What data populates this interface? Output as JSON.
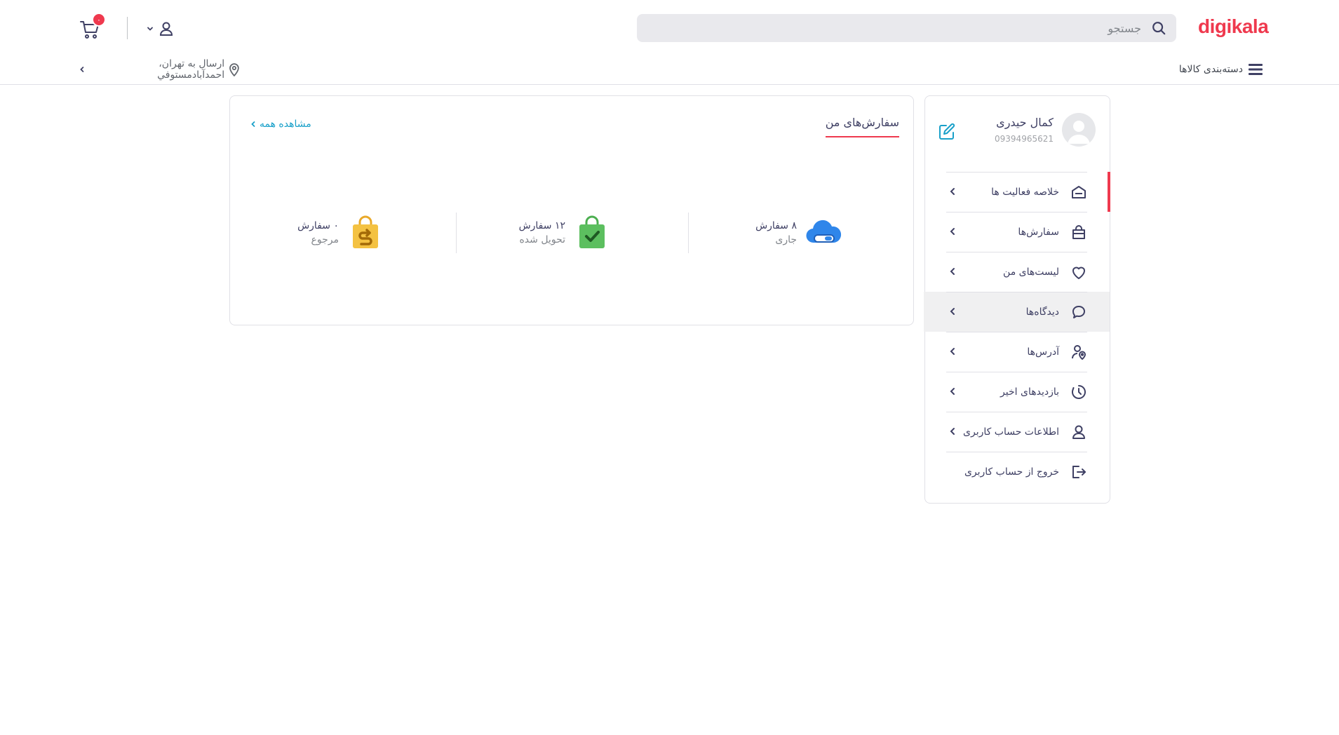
{
  "header": {
    "logo": "digikala",
    "search_placeholder": "جستجو",
    "cart_count": "۰",
    "categories_label": "دسته‌بندی کالاها",
    "location_label": "ارسال به تهران، احمدآبادمستوفي"
  },
  "sidebar": {
    "user_name": "کمال حیدری",
    "user_phone": "09394965621",
    "items": [
      {
        "label": "خلاصه فعالیت ها",
        "icon": "home-icon"
      },
      {
        "label": "سفارش‌ها",
        "icon": "bag-icon"
      },
      {
        "label": "لیست‌های من",
        "icon": "heart-icon"
      },
      {
        "label": "دیدگاه‌ها",
        "icon": "comment-icon"
      },
      {
        "label": "آدرس‌ها",
        "icon": "location-icon"
      },
      {
        "label": "بازدیدهای اخیر",
        "icon": "clock-icon"
      },
      {
        "label": "اطلاعات حساب کاربری",
        "icon": "user-icon"
      },
      {
        "label": "خروج از حساب کاربری",
        "icon": "logout-icon"
      }
    ]
  },
  "orders": {
    "title": "سفارش‌های من",
    "see_all": "مشاهده همه",
    "stats": [
      {
        "count": "۸ سفارش",
        "label": "جاری",
        "icon": "processing-cloud-icon"
      },
      {
        "count": "۱۲ سفارش",
        "label": "تحویل شده",
        "icon": "delivered-bag-icon"
      },
      {
        "count": "۰ سفارش",
        "label": "مرجوع",
        "icon": "returned-bag-icon"
      }
    ]
  },
  "colors": {
    "brand": "#ef394e",
    "link": "#19a0c9",
    "text": "#3f4064",
    "muted": "#81858b"
  }
}
